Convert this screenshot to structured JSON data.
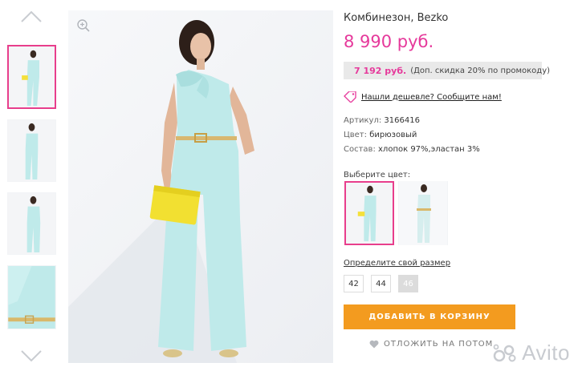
{
  "product": {
    "title": "Комбинезон, Bezko",
    "price": "8 990 руб.",
    "promo_price": "7 192 руб.",
    "promo_note": "(Доп. скидка 20% по промокоду)",
    "cheaper_link": "Нашли дешевле? Сообщите нам!"
  },
  "attributes": [
    {
      "label": "Артикул:",
      "value": "3166416"
    },
    {
      "label": "Цвет:",
      "value": "бирюзовый"
    },
    {
      "label": "Состав:",
      "value": "хлопок 97%,эластан 3%"
    }
  ],
  "color_select": {
    "label": "Выберите цвет:",
    "selected_index": 0
  },
  "size_select": {
    "label": "Определите свой размер",
    "sizes": [
      {
        "label": "42",
        "available": true
      },
      {
        "label": "44",
        "available": true
      },
      {
        "label": "46",
        "available": false
      }
    ]
  },
  "actions": {
    "add_to_cart": "ДОБАВИТЬ В КОРЗИНУ",
    "save_later": "ОТЛОЖИТЬ НА ПОТОМ"
  },
  "gallery": {
    "thumbnail_count": 4,
    "active_index": 0
  },
  "watermark": "Avito",
  "colors": {
    "accent_pink": "#e6399b",
    "button_orange": "#f39b1f",
    "garment_mint": "#bfeaea"
  },
  "icons": [
    "chevron-up-icon",
    "chevron-down-icon",
    "zoom-icon",
    "clock-icon",
    "price-tag-icon",
    "heart-icon",
    "avito-logo-icon"
  ]
}
